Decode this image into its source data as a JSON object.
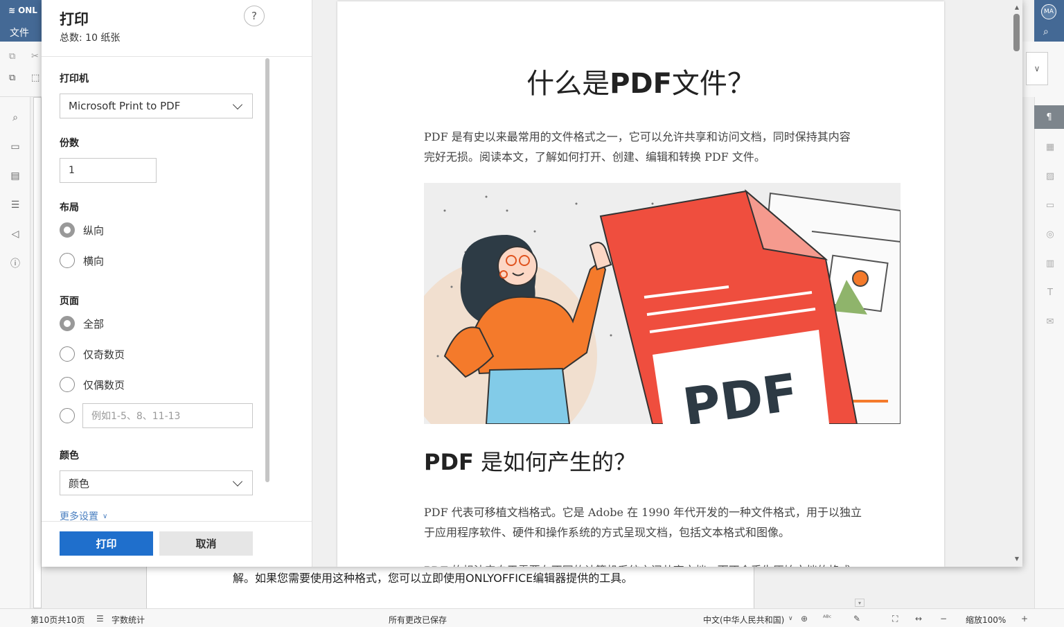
{
  "app": {
    "logo_text": "ONL",
    "file_tab": "文件",
    "user_initials": "MA"
  },
  "dialog": {
    "title": "打印",
    "total_label": "总数: 10 纸张",
    "help": "?",
    "printer": {
      "label": "打印机",
      "value": "Microsoft Print to PDF"
    },
    "copies": {
      "label": "份数",
      "value": "1"
    },
    "layout": {
      "label": "布局",
      "options": [
        "纵向",
        "横向"
      ],
      "selected": "纵向"
    },
    "pages": {
      "label": "页面",
      "options": [
        "全部",
        "仅奇数页",
        "仅偶数页"
      ],
      "selected": "全部",
      "range_placeholder": "例如1-5、8、11-13"
    },
    "color": {
      "label": "颜色",
      "value": "颜色"
    },
    "more_settings": "更多设置",
    "print_button": "打印",
    "cancel_button": "取消"
  },
  "preview": {
    "title_prefix": "什么是",
    "title_bold": "PDF",
    "title_suffix": "文件？",
    "para1_line1": "PDF 是有史以来最常用的文件格式之一，它可以允许共享和访问文档，同时保持其内容",
    "para1_line2": "完好无损。阅读本文，了解如何打开、创建、编辑和转换 PDF 文件。",
    "illustration_text": "PDF",
    "h2_bold": "PDF",
    "h2_rest": " 是如何产生的？",
    "para2_line1": "PDF 代表可移植文档格式。它是 Adobe 在 1990 年代开发的一种文件格式，用于以独立",
    "para2_line2": "于应用程序软件、硬件和操作系统的方式呈现文档，包括文本格式和图像。",
    "para3_cut": "PDF 的想法来自于需要在不同的计算机系统之间共享文档，而不会丢失原始文档的格式"
  },
  "document": {
    "visible_line": "解。如果您需要使用这种格式，您可以立即使用ONLYOFFICE编辑器提供的工具。"
  },
  "statusbar": {
    "page_info": "第10页共10页",
    "word_count": "字数统计",
    "save_status": "所有更改已保存",
    "language": "中文(中华人民共和国)",
    "zoom": "缩放100%"
  }
}
